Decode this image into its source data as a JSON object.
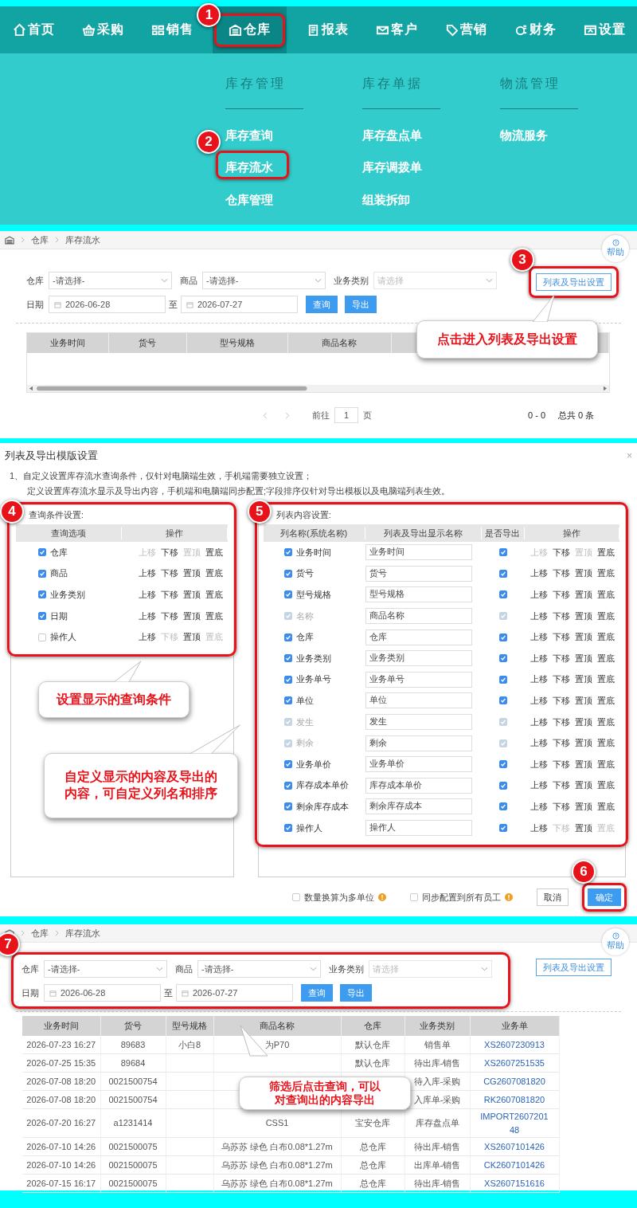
{
  "nav": {
    "items": [
      {
        "label": "首页",
        "selected": false
      },
      {
        "label": "采购",
        "selected": false
      },
      {
        "label": "销售",
        "selected": false
      },
      {
        "label": "仓库",
        "selected": true,
        "step": "1"
      },
      {
        "label": "报表",
        "selected": false
      },
      {
        "label": "客户",
        "selected": false
      },
      {
        "label": "营销",
        "selected": false
      },
      {
        "label": "财务",
        "selected": false
      },
      {
        "label": "设置",
        "selected": false
      }
    ]
  },
  "menu": {
    "columns": [
      {
        "heading": "库存管理",
        "items": [
          {
            "label": "库存查询"
          },
          {
            "label": "库存流水",
            "step": "2"
          },
          {
            "label": "仓库管理"
          }
        ]
      },
      {
        "heading": "库存单据",
        "items": [
          {
            "label": "库存盘点单"
          },
          {
            "label": "库存调拨单"
          },
          {
            "label": "组装拆卸"
          }
        ]
      },
      {
        "heading": "物流管理",
        "items": [
          {
            "label": "物流服务"
          }
        ]
      }
    ]
  },
  "stock_page": {
    "breadcrumb": [
      "仓库",
      "库存流水"
    ],
    "help": "帮助",
    "filters": [
      {
        "label": "仓库",
        "value": "-请选择-"
      },
      {
        "label": "商品",
        "value": "-请选择-"
      },
      {
        "label": "业务类别",
        "placeholder": "请选择"
      }
    ],
    "date": {
      "label": "日期",
      "from": "2026-06-28",
      "sep": "至",
      "to": "2026-07-27"
    },
    "buttons": [
      "查询",
      "导出"
    ],
    "settings_button": {
      "label": "列表及导出设置",
      "step": "3"
    },
    "table": {
      "columns": [
        "业务时间",
        "货号",
        "型号规格",
        "商品名称"
      ]
    },
    "pager": {
      "goto": "前往",
      "page": "1",
      "unit": "页",
      "range": "0 - 0",
      "total": "总共 0 条"
    },
    "callout": [
      "点击进入列表及导出设置"
    ]
  },
  "dialog": {
    "title": "列表及导出模版设置",
    "close": "×",
    "notes": [
      "1、自定义设置库存流水查询条件，仅针对电脑端生效，手机端需要独立设置；",
      "定义设置库存流水显示及导出内容，手机端和电脑端同步配置;字段排序仅针对导出模板以及电脑端列表生效。"
    ],
    "query_panel": {
      "title": "查询条件设置:",
      "step": "4",
      "columns": [
        "查询选项",
        "操作"
      ],
      "rows": [
        {
          "name": "仓库",
          "checked": true,
          "ops": [
            {
              "label": "上移",
              "disabled": true
            },
            {
              "label": "下移",
              "disabled": false
            },
            {
              "label": "置顶",
              "disabled": true
            },
            {
              "label": "置底",
              "disabled": false
            }
          ]
        },
        {
          "name": "商品",
          "checked": true,
          "ops": [
            {
              "label": "上移",
              "disabled": false
            },
            {
              "label": "下移",
              "disabled": false
            },
            {
              "label": "置顶",
              "disabled": false
            },
            {
              "label": "置底",
              "disabled": false
            }
          ]
        },
        {
          "name": "业务类别",
          "checked": true,
          "ops": [
            {
              "label": "上移",
              "disabled": false
            },
            {
              "label": "下移",
              "disabled": false
            },
            {
              "label": "置顶",
              "disabled": false
            },
            {
              "label": "置底",
              "disabled": false
            }
          ]
        },
        {
          "name": "日期",
          "checked": true,
          "ops": [
            {
              "label": "上移",
              "disabled": false
            },
            {
              "label": "下移",
              "disabled": false
            },
            {
              "label": "置顶",
              "disabled": false
            },
            {
              "label": "置底",
              "disabled": false
            }
          ]
        },
        {
          "name": "操作人",
          "checked": false,
          "ops": [
            {
              "label": "上移",
              "disabled": false
            },
            {
              "label": "下移",
              "disabled": true
            },
            {
              "label": "置顶",
              "disabled": false
            },
            {
              "label": "置底",
              "disabled": true
            }
          ]
        }
      ]
    },
    "column_panel": {
      "title": "列表内容设置:",
      "step": "5",
      "columns": [
        "列名称(系统名称)",
        "列表及导出显示名称",
        "是否导出",
        "操作"
      ],
      "rows": [
        {
          "name": "业务时间",
          "checked": true,
          "locked": false,
          "display": "业务时间",
          "export": true,
          "ops": [
            {
              "label": "上移",
              "disabled": true
            },
            {
              "label": "下移",
              "disabled": false
            },
            {
              "label": "置顶",
              "disabled": true
            },
            {
              "label": "置底",
              "disabled": false
            }
          ]
        },
        {
          "name": "货号",
          "checked": true,
          "locked": false,
          "display": "货号",
          "export": true,
          "ops": [
            {
              "label": "上移",
              "disabled": false
            },
            {
              "label": "下移",
              "disabled": false
            },
            {
              "label": "置顶",
              "disabled": false
            },
            {
              "label": "置底",
              "disabled": false
            }
          ]
        },
        {
          "name": "型号规格",
          "checked": true,
          "locked": false,
          "display": "型号规格",
          "export": true,
          "ops": [
            {
              "label": "上移",
              "disabled": false
            },
            {
              "label": "下移",
              "disabled": false
            },
            {
              "label": "置顶",
              "disabled": false
            },
            {
              "label": "置底",
              "disabled": false
            }
          ]
        },
        {
          "name": "名称",
          "checked": true,
          "locked": true,
          "display": "商品名称",
          "export": true,
          "ops": [
            {
              "label": "上移",
              "disabled": false
            },
            {
              "label": "下移",
              "disabled": false
            },
            {
              "label": "置顶",
              "disabled": false
            },
            {
              "label": "置底",
              "disabled": false
            }
          ]
        },
        {
          "name": "仓库",
          "checked": true,
          "locked": false,
          "display": "仓库",
          "export": true,
          "ops": [
            {
              "label": "上移",
              "disabled": false
            },
            {
              "label": "下移",
              "disabled": false
            },
            {
              "label": "置顶",
              "disabled": false
            },
            {
              "label": "置底",
              "disabled": false
            }
          ]
        },
        {
          "name": "业务类别",
          "checked": true,
          "locked": false,
          "display": "业务类别",
          "export": true,
          "ops": [
            {
              "label": "上移",
              "disabled": false
            },
            {
              "label": "下移",
              "disabled": false
            },
            {
              "label": "置顶",
              "disabled": false
            },
            {
              "label": "置底",
              "disabled": false
            }
          ]
        },
        {
          "name": "业务单号",
          "checked": true,
          "locked": false,
          "display": "业务单号",
          "export": true,
          "ops": [
            {
              "label": "上移",
              "disabled": false
            },
            {
              "label": "下移",
              "disabled": false
            },
            {
              "label": "置顶",
              "disabled": false
            },
            {
              "label": "置底",
              "disabled": false
            }
          ]
        },
        {
          "name": "单位",
          "checked": true,
          "locked": false,
          "display": "单位",
          "export": true,
          "ops": [
            {
              "label": "上移",
              "disabled": false
            },
            {
              "label": "下移",
              "disabled": false
            },
            {
              "label": "置顶",
              "disabled": false
            },
            {
              "label": "置底",
              "disabled": false
            }
          ]
        },
        {
          "name": "发生",
          "checked": true,
          "locked": true,
          "display": "发生",
          "export": true,
          "ops": [
            {
              "label": "上移",
              "disabled": false
            },
            {
              "label": "下移",
              "disabled": false
            },
            {
              "label": "置顶",
              "disabled": false
            },
            {
              "label": "置底",
              "disabled": false
            }
          ]
        },
        {
          "name": "剩余",
          "checked": true,
          "locked": true,
          "display": "剩余",
          "export": true,
          "ops": [
            {
              "label": "上移",
              "disabled": false
            },
            {
              "label": "下移",
              "disabled": false
            },
            {
              "label": "置顶",
              "disabled": false
            },
            {
              "label": "置底",
              "disabled": false
            }
          ]
        },
        {
          "name": "业务单价",
          "checked": true,
          "locked": false,
          "display": "业务单价",
          "export": true,
          "ops": [
            {
              "label": "上移",
              "disabled": false
            },
            {
              "label": "下移",
              "disabled": false
            },
            {
              "label": "置顶",
              "disabled": false
            },
            {
              "label": "置底",
              "disabled": false
            }
          ]
        },
        {
          "name": "库存成本单价",
          "checked": true,
          "locked": false,
          "display": "库存成本单价",
          "export": true,
          "ops": [
            {
              "label": "上移",
              "disabled": false
            },
            {
              "label": "下移",
              "disabled": false
            },
            {
              "label": "置顶",
              "disabled": false
            },
            {
              "label": "置底",
              "disabled": false
            }
          ]
        },
        {
          "name": "剩余库存成本",
          "checked": true,
          "locked": false,
          "display": "剩余库存成本",
          "export": true,
          "ops": [
            {
              "label": "上移",
              "disabled": false
            },
            {
              "label": "下移",
              "disabled": false
            },
            {
              "label": "置顶",
              "disabled": false
            },
            {
              "label": "置底",
              "disabled": false
            }
          ]
        },
        {
          "name": "操作人",
          "checked": true,
          "locked": false,
          "display": "操作人",
          "export": true,
          "ops": [
            {
              "label": "上移",
              "disabled": false
            },
            {
              "label": "下移",
              "disabled": true
            },
            {
              "label": "置顶",
              "disabled": false
            },
            {
              "label": "置底",
              "disabled": true
            }
          ]
        }
      ]
    },
    "options": [
      {
        "label": "数量换算为多单位",
        "checked": false
      },
      {
        "label": "同步配置到所有员工",
        "checked": false
      }
    ],
    "cancel": "取消",
    "confirm": {
      "label": "确定",
      "step": "6"
    },
    "callouts": [
      [
        "设置显示的查询条件"
      ],
      [
        "自定义显示的内容及导出的",
        "内容，可自定义列名和排序"
      ]
    ]
  },
  "result_page": {
    "breadcrumb": [
      "仓库",
      "库存流水"
    ],
    "help": "帮助",
    "form_step": "7",
    "filters": [
      {
        "label": "仓库",
        "value": "-请选择-"
      },
      {
        "label": "商品",
        "value": "-请选择-"
      },
      {
        "label": "业务类别",
        "placeholder": "请选择"
      }
    ],
    "date": {
      "label": "日期",
      "from": "2026-06-28",
      "sep": "至",
      "to": "2026-07-27"
    },
    "buttons": [
      "查询",
      "导出"
    ],
    "settings_button": {
      "label": "列表及导出设置"
    },
    "table": {
      "columns": [
        "业务时间",
        "货号",
        "型号规格",
        "商品名称",
        "仓库",
        "业务类别",
        "业务单"
      ],
      "rows": [
        [
          "2026-07-23 16:27",
          "89683",
          "小白8",
          "为P70",
          "默认仓库",
          "销售单",
          "XS2607230913"
        ],
        [
          "2026-07-25 15:35",
          "89684",
          null,
          null,
          "默认仓库",
          "待出库-销售",
          "XS2607251535"
        ],
        [
          "2026-07-08 18:20",
          "0021500754",
          null,
          null,
          null,
          "待入库-采购",
          "CG2607081820"
        ],
        [
          "2026-07-08 18:20",
          "0021500754",
          null,
          null,
          null,
          "入库单-采购",
          "RK2607081820"
        ],
        [
          "2026-07-20 16:27",
          "a1231414",
          null,
          "CSS1",
          "宝安仓库",
          "库存盘点单",
          "IMPORT2607201\n48"
        ],
        [
          "2026-07-10 14:26",
          "0021500075",
          null,
          "乌苏苏 绿色 白布0.08*1.27m",
          "总仓库",
          "待出库-销售",
          "XS2607101426"
        ],
        [
          "2026-07-10 14:26",
          "0021500075",
          null,
          "乌苏苏 绿色 白布0.08*1.27m",
          "总仓库",
          "出库单-销售",
          "CK2607101426"
        ],
        [
          "2026-07-15 16:17",
          "0021500075",
          null,
          "乌苏苏 绿色 白布0.08*1.27m",
          "总仓库",
          "待出库-销售",
          "XS2607151616"
        ]
      ]
    },
    "callout": [
      "筛选后点击查询，可以",
      "对查询出的内容导出"
    ]
  }
}
